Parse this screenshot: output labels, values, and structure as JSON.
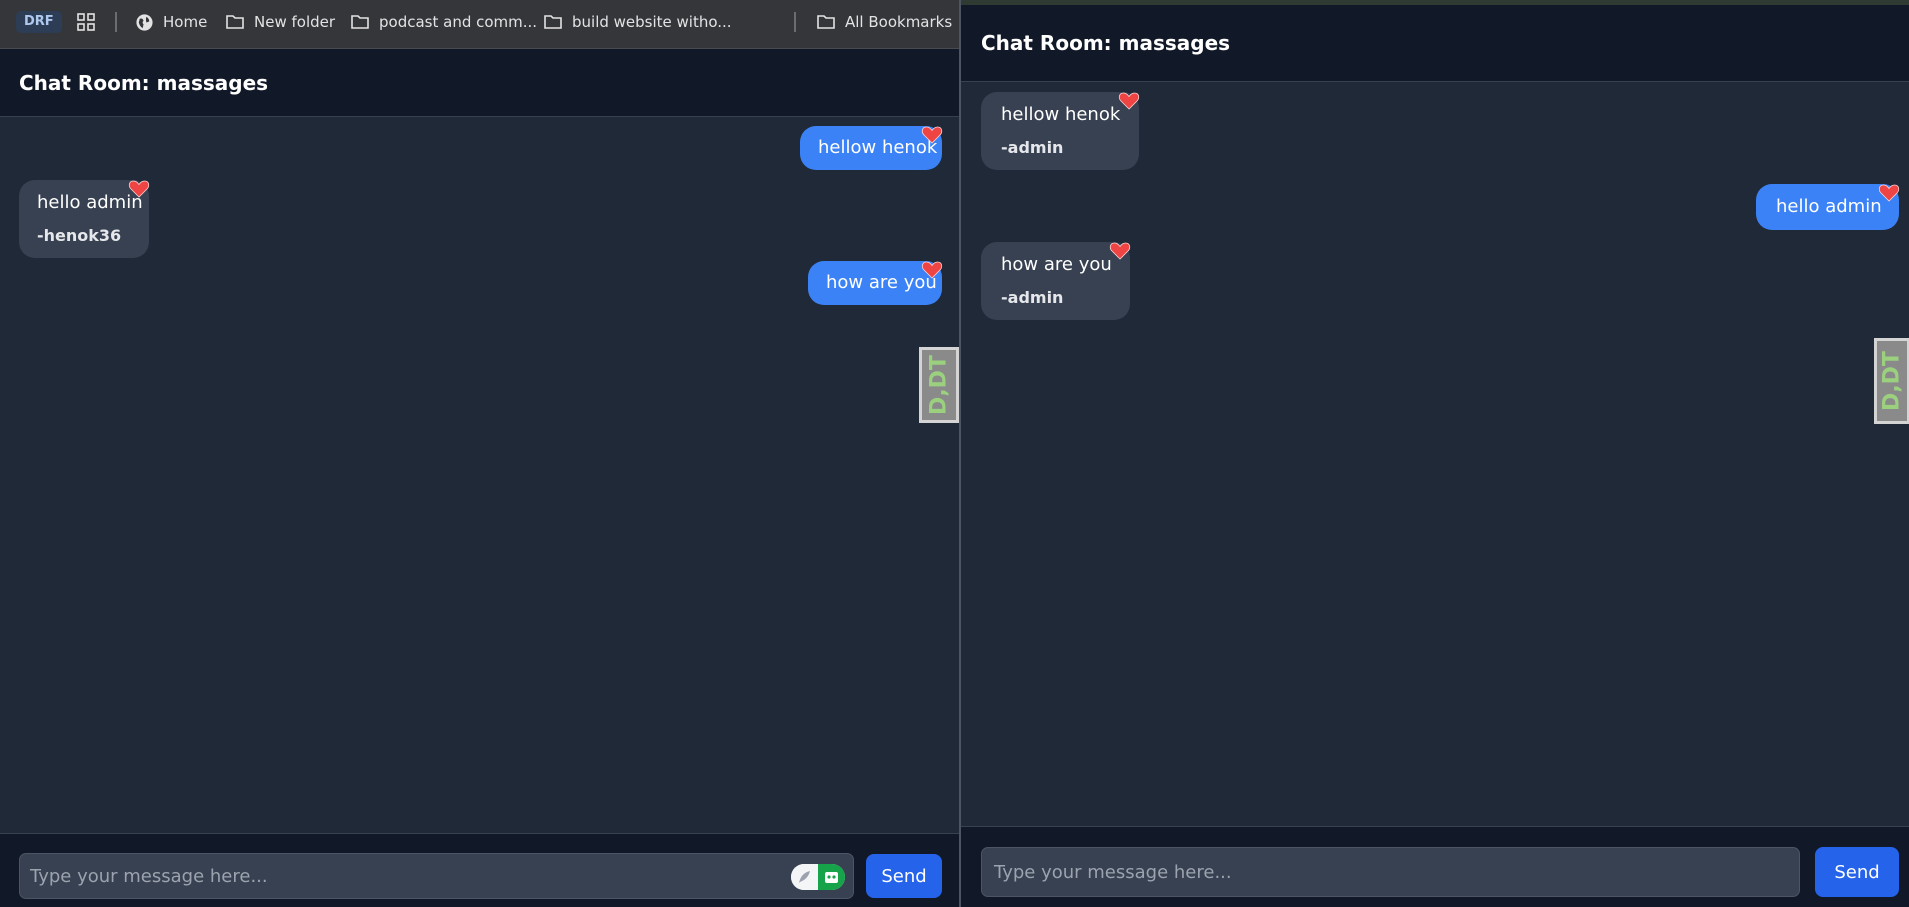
{
  "bookmarks": {
    "profile_label": "DRF",
    "items": [
      "Home",
      "New folder",
      "podcast and comm...",
      "build website witho...",
      "All Bookmarks"
    ]
  },
  "left": {
    "title": "Chat Room: massages",
    "messages": [
      {
        "text": "hellow henok",
        "author": "",
        "type": "sent"
      },
      {
        "text": "hello admin",
        "author": "-henok36",
        "type": "received"
      },
      {
        "text": "how are you",
        "author": "",
        "type": "sent"
      }
    ],
    "placeholder": "Type your message here...",
    "send_label": "Send"
  },
  "right": {
    "title": "Chat Room: massages",
    "messages": [
      {
        "text": "hellow henok",
        "author": "-admin",
        "type": "received"
      },
      {
        "text": "hello admin",
        "author": "",
        "type": "sent"
      },
      {
        "text": "how are you",
        "author": "-admin",
        "type": "received"
      }
    ],
    "placeholder": "Type your message here...",
    "send_label": "Send"
  },
  "extension_badge": "D,DT",
  "colors": {
    "page_bg": "#1f2937",
    "header_bg": "#111827",
    "sent_bubble": "#3b82f6",
    "received_bubble": "#374151",
    "send_button": "#2563eb",
    "heart": "#ef4444"
  },
  "icons": {
    "reaction": "heart-icon",
    "apps": "apps-grid-icon",
    "home": "globe-icon",
    "folder": "folder-icon"
  }
}
